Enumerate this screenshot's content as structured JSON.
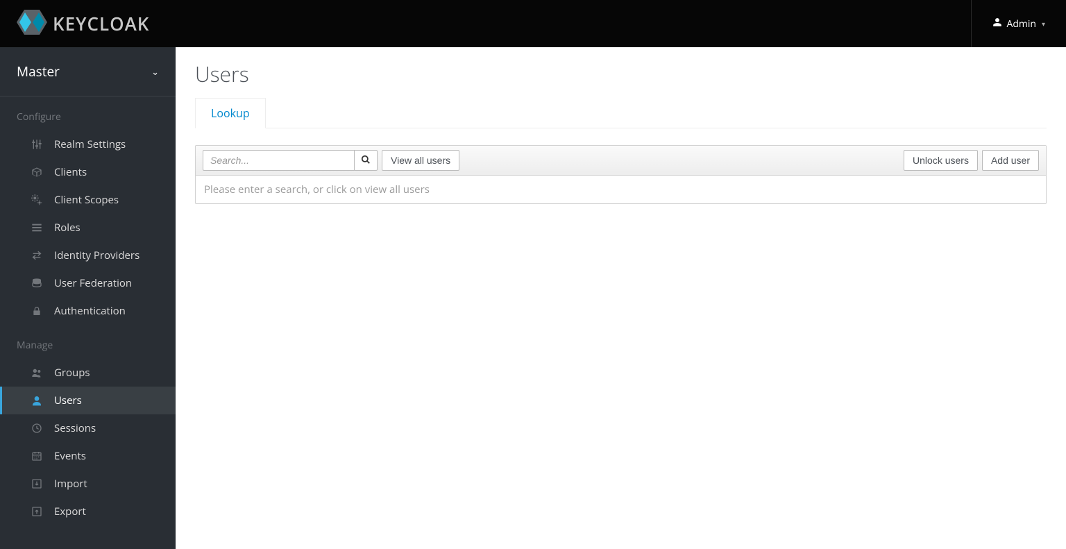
{
  "header": {
    "brand": "KEYCLOAK",
    "user_label": "Admin"
  },
  "sidebar": {
    "realm": "Master",
    "sections": [
      {
        "title": "Configure",
        "items": [
          {
            "icon": "sliders",
            "label": "Realm Settings"
          },
          {
            "icon": "cube",
            "label": "Clients"
          },
          {
            "icon": "cogs",
            "label": "Client Scopes"
          },
          {
            "icon": "list",
            "label": "Roles"
          },
          {
            "icon": "exchange",
            "label": "Identity Providers"
          },
          {
            "icon": "database",
            "label": "User Federation"
          },
          {
            "icon": "lock",
            "label": "Authentication"
          }
        ]
      },
      {
        "title": "Manage",
        "items": [
          {
            "icon": "group",
            "label": "Groups"
          },
          {
            "icon": "user",
            "label": "Users",
            "active": true
          },
          {
            "icon": "clock",
            "label": "Sessions"
          },
          {
            "icon": "calendar",
            "label": "Events"
          },
          {
            "icon": "import",
            "label": "Import"
          },
          {
            "icon": "export",
            "label": "Export"
          }
        ]
      }
    ]
  },
  "main": {
    "title": "Users",
    "tab": "Lookup",
    "search_placeholder": "Search...",
    "view_all_label": "View all users",
    "unlock_label": "Unlock users",
    "add_label": "Add user",
    "empty_message": "Please enter a search, or click on view all users"
  }
}
